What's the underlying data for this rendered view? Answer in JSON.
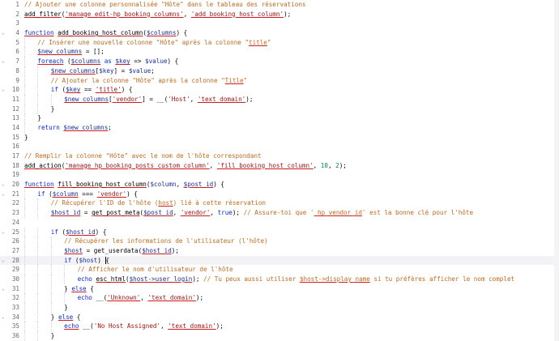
{
  "editor": {
    "lines": [
      {
        "n": "1",
        "fold": "",
        "ind": 0,
        "tokens": [
          {
            "t": "// Ajouter une colonne personnalisée \"Hôte\" dans le tableau des réservations",
            "c": "comment"
          }
        ]
      },
      {
        "n": "2",
        "fold": "",
        "ind": 0,
        "tokens": [
          {
            "t": "add_filter",
            "c": "function",
            "e": 1
          },
          {
            "t": "(",
            "c": "plain"
          },
          {
            "t": "'manage_edit-hp_booking_columns'",
            "c": "string",
            "e": 1
          },
          {
            "t": ", ",
            "c": "plain"
          },
          {
            "t": "'add_booking_host_column'",
            "c": "string",
            "e": 1
          },
          {
            "t": ");",
            "c": "plain"
          }
        ]
      },
      {
        "n": "3",
        "fold": "",
        "ind": 0,
        "tokens": []
      },
      {
        "n": "4",
        "fold": "v",
        "ind": 0,
        "tokens": [
          {
            "t": "function",
            "c": "keyword",
            "e": 1
          },
          {
            "t": " ",
            "c": "plain"
          },
          {
            "t": "add_booking_host_column",
            "c": "function",
            "e": 1
          },
          {
            "t": "(",
            "c": "plain"
          },
          {
            "t": "$columns",
            "c": "variable",
            "e": 1
          },
          {
            "t": ") {",
            "c": "plain"
          }
        ]
      },
      {
        "n": "5",
        "fold": "",
        "ind": 1,
        "tokens": [
          {
            "t": "// Insérer une nouvelle colonne \"Hôte\" après la colonne \"",
            "c": "comment"
          },
          {
            "t": "title",
            "c": "comment",
            "e": 1
          },
          {
            "t": "\"",
            "c": "comment"
          }
        ]
      },
      {
        "n": "6",
        "fold": "",
        "ind": 1,
        "tokens": [
          {
            "t": "$new_columns",
            "c": "variable",
            "e": 1
          },
          {
            "t": " = [];",
            "c": "plain"
          }
        ]
      },
      {
        "n": "7",
        "fold": "v",
        "ind": 1,
        "tokens": [
          {
            "t": "foreach",
            "c": "keyword",
            "e": 1
          },
          {
            "t": " (",
            "c": "plain"
          },
          {
            "t": "$columns",
            "c": "variable",
            "e": 1
          },
          {
            "t": " as ",
            "c": "keyword"
          },
          {
            "t": "$key",
            "c": "variable",
            "e": 1
          },
          {
            "t": " => ",
            "c": "plain"
          },
          {
            "t": "$value",
            "c": "variable"
          },
          {
            "t": ") {",
            "c": "plain"
          }
        ]
      },
      {
        "n": "8",
        "fold": "",
        "ind": 2,
        "tokens": [
          {
            "t": "$new_columns",
            "c": "variable",
            "e": 1
          },
          {
            "t": "[",
            "c": "plain"
          },
          {
            "t": "$key",
            "c": "variable"
          },
          {
            "t": "] = ",
            "c": "plain"
          },
          {
            "t": "$value",
            "c": "variable"
          },
          {
            "t": ";",
            "c": "plain"
          }
        ]
      },
      {
        "n": "9",
        "fold": "",
        "ind": 2,
        "tokens": [
          {
            "t": "// Ajouter la colonne \"Hôte\" après la colonne \"",
            "c": "comment"
          },
          {
            "t": "Title",
            "c": "comment",
            "e": 1
          },
          {
            "t": "\"",
            "c": "comment"
          }
        ]
      },
      {
        "n": "10",
        "fold": "v",
        "ind": 2,
        "tokens": [
          {
            "t": "if",
            "c": "keyword"
          },
          {
            "t": " (",
            "c": "plain"
          },
          {
            "t": "$key",
            "c": "variable",
            "e": 1
          },
          {
            "t": " == ",
            "c": "plain"
          },
          {
            "t": "'title'",
            "c": "string",
            "e": 1
          },
          {
            "t": ") {",
            "c": "plain"
          }
        ]
      },
      {
        "n": "11",
        "fold": "",
        "ind": 3,
        "tokens": [
          {
            "t": "$new_columns",
            "c": "variable",
            "e": 1
          },
          {
            "t": "[",
            "c": "plain"
          },
          {
            "t": "'vendor'",
            "c": "string",
            "e": 1
          },
          {
            "t": "] = __(",
            "c": "plain"
          },
          {
            "t": "'Host'",
            "c": "string"
          },
          {
            "t": ", ",
            "c": "plain"
          },
          {
            "t": "'text_domain'",
            "c": "string",
            "e": 1
          },
          {
            "t": ");",
            "c": "plain"
          }
        ]
      },
      {
        "n": "12",
        "fold": "",
        "ind": 2,
        "tokens": [
          {
            "t": "}",
            "c": "plain"
          }
        ]
      },
      {
        "n": "13",
        "fold": "",
        "ind": 1,
        "tokens": [
          {
            "t": "}",
            "c": "plain"
          }
        ]
      },
      {
        "n": "14",
        "fold": "",
        "ind": 1,
        "tokens": [
          {
            "t": "return",
            "c": "keyword"
          },
          {
            "t": " ",
            "c": "plain"
          },
          {
            "t": "$new_columns",
            "c": "variable",
            "e": 1
          },
          {
            "t": ";",
            "c": "plain"
          }
        ]
      },
      {
        "n": "15",
        "fold": "",
        "ind": 0,
        "tokens": [
          {
            "t": "}",
            "c": "plain"
          }
        ]
      },
      {
        "n": "16",
        "fold": "",
        "ind": 0,
        "tokens": []
      },
      {
        "n": "17",
        "fold": "",
        "ind": 0,
        "tokens": [
          {
            "t": "// Remplir la colonne \"Hôte\" avec le nom de l'hôte correspondant",
            "c": "comment"
          }
        ]
      },
      {
        "n": "18",
        "fold": "",
        "ind": 0,
        "tokens": [
          {
            "t": "add_action",
            "c": "function",
            "e": 1
          },
          {
            "t": "(",
            "c": "plain"
          },
          {
            "t": "'manage_hp_booking_posts_custom_column'",
            "c": "string",
            "e": 1
          },
          {
            "t": ", ",
            "c": "plain"
          },
          {
            "t": "'fill_booking_host_column'",
            "c": "string",
            "e": 1
          },
          {
            "t": ", ",
            "c": "plain"
          },
          {
            "t": "10",
            "c": "number"
          },
          {
            "t": ", ",
            "c": "plain"
          },
          {
            "t": "2",
            "c": "number"
          },
          {
            "t": ");",
            "c": "plain"
          }
        ]
      },
      {
        "n": "19",
        "fold": "",
        "ind": 0,
        "tokens": []
      },
      {
        "n": "20",
        "fold": "v",
        "ind": 0,
        "tokens": [
          {
            "t": "function",
            "c": "keyword",
            "e": 1
          },
          {
            "t": " ",
            "c": "plain"
          },
          {
            "t": "fill_booking_host_column",
            "c": "function",
            "e": 1
          },
          {
            "t": "(",
            "c": "plain"
          },
          {
            "t": "$column",
            "c": "variable"
          },
          {
            "t": ", ",
            "c": "plain"
          },
          {
            "t": "$post_id",
            "c": "variable",
            "e": 1
          },
          {
            "t": ") {",
            "c": "plain"
          }
        ]
      },
      {
        "n": "21",
        "fold": "v",
        "ind": 1,
        "tokens": [
          {
            "t": "if",
            "c": "keyword"
          },
          {
            "t": " (",
            "c": "plain"
          },
          {
            "t": "$column",
            "c": "variable",
            "e": 1
          },
          {
            "t": " === ",
            "c": "plain"
          },
          {
            "t": "'vendor'",
            "c": "string",
            "e": 1
          },
          {
            "t": ") {",
            "c": "plain"
          }
        ]
      },
      {
        "n": "22",
        "fold": "",
        "ind": 2,
        "tokens": [
          {
            "t": "// Récupérer l'ID de l'hôte (",
            "c": "comment"
          },
          {
            "t": "host",
            "c": "comment",
            "e": 1
          },
          {
            "t": ") lié à cette réservation",
            "c": "comment"
          }
        ]
      },
      {
        "n": "23",
        "fold": "",
        "ind": 2,
        "tokens": [
          {
            "t": "$host_id",
            "c": "variable",
            "e": 1
          },
          {
            "t": " = ",
            "c": "plain"
          },
          {
            "t": "get_post_meta",
            "c": "function",
            "e": 1
          },
          {
            "t": "(",
            "c": "plain"
          },
          {
            "t": "$post_id",
            "c": "variable",
            "e": 1
          },
          {
            "t": ", ",
            "c": "plain"
          },
          {
            "t": "'vendor'",
            "c": "string",
            "e": 1
          },
          {
            "t": ", ",
            "c": "plain"
          },
          {
            "t": "true",
            "c": "keyword"
          },
          {
            "t": "); ",
            "c": "plain"
          },
          {
            "t": "// Assure-toi que '",
            "c": "comment"
          },
          {
            "t": "_hp_vendor_id",
            "c": "comment",
            "e": 1
          },
          {
            "t": "' est la bonne clé pour l'hôte",
            "c": "comment"
          }
        ]
      },
      {
        "n": "24",
        "fold": "",
        "ind": 0,
        "tokens": []
      },
      {
        "n": "25",
        "fold": "v",
        "ind": 2,
        "tokens": [
          {
            "t": "if",
            "c": "keyword"
          },
          {
            "t": " (",
            "c": "plain"
          },
          {
            "t": "$host_id",
            "c": "variable",
            "e": 1
          },
          {
            "t": ") {",
            "c": "plain"
          }
        ]
      },
      {
        "n": "26",
        "fold": "",
        "ind": 3,
        "tokens": [
          {
            "t": "// Récupérer les informations de l'utilisateur (l'hôte)",
            "c": "comment"
          }
        ]
      },
      {
        "n": "27",
        "fold": "",
        "ind": 3,
        "tokens": [
          {
            "t": "$host",
            "c": "variable",
            "e": 1
          },
          {
            "t": " = ",
            "c": "plain"
          },
          {
            "t": "get_userdata",
            "c": "function"
          },
          {
            "t": "(",
            "c": "plain"
          },
          {
            "t": "$host_id",
            "c": "variable",
            "e": 1
          },
          {
            "t": ");",
            "c": "plain"
          }
        ]
      },
      {
        "n": "28",
        "fold": "v",
        "ind": 3,
        "cur": 1,
        "tokens": [
          {
            "t": "if",
            "c": "keyword"
          },
          {
            "t": " (",
            "c": "plain"
          },
          {
            "t": "$host",
            "c": "variable"
          },
          {
            "t": ") ",
            "c": "plain"
          },
          {
            "t": "{",
            "c": "plain",
            "cursor": 1
          }
        ]
      },
      {
        "n": "29",
        "fold": "",
        "ind": 4,
        "tokens": [
          {
            "t": "// Afficher le nom d'utilisateur de l'hôte",
            "c": "comment"
          }
        ]
      },
      {
        "n": "30",
        "fold": "",
        "ind": 4,
        "tokens": [
          {
            "t": "echo",
            "c": "keyword"
          },
          {
            "t": " ",
            "c": "plain"
          },
          {
            "t": "esc_html",
            "c": "function",
            "e": 1
          },
          {
            "t": "(",
            "c": "plain"
          },
          {
            "t": "$host->user_login",
            "c": "variable",
            "e": 1
          },
          {
            "t": "); ",
            "c": "plain"
          },
          {
            "t": "// Tu peux aussi utiliser ",
            "c": "comment"
          },
          {
            "t": "$host->display_name",
            "c": "comment",
            "e": 1
          },
          {
            "t": " si tu préfères afficher le nom complet",
            "c": "comment"
          }
        ]
      },
      {
        "n": "31",
        "fold": "v",
        "ind": 3,
        "tokens": [
          {
            "t": "} ",
            "c": "plain"
          },
          {
            "t": "else",
            "c": "keyword",
            "e": 1
          },
          {
            "t": " {",
            "c": "plain"
          }
        ]
      },
      {
        "n": "32",
        "fold": "",
        "ind": 4,
        "tokens": [
          {
            "t": "echo",
            "c": "keyword"
          },
          {
            "t": " __(",
            "c": "plain"
          },
          {
            "t": "'Unknown'",
            "c": "string",
            "e": 1
          },
          {
            "t": ", ",
            "c": "plain"
          },
          {
            "t": "'text_domain'",
            "c": "string",
            "e": 1
          },
          {
            "t": ");",
            "c": "plain"
          }
        ]
      },
      {
        "n": "33",
        "fold": "",
        "ind": 3,
        "tokens": [
          {
            "t": "}",
            "c": "plain"
          }
        ]
      },
      {
        "n": "34",
        "fold": "v",
        "ind": 2,
        "tokens": [
          {
            "t": "} ",
            "c": "plain"
          },
          {
            "t": "else",
            "c": "keyword",
            "e": 1
          },
          {
            "t": " {",
            "c": "plain"
          }
        ]
      },
      {
        "n": "35",
        "fold": "",
        "ind": 3,
        "tokens": [
          {
            "t": "echo",
            "c": "keyword",
            "e": 1
          },
          {
            "t": " __(",
            "c": "plain"
          },
          {
            "t": "'No Host Assigned'",
            "c": "string"
          },
          {
            "t": ", ",
            "c": "plain"
          },
          {
            "t": "'text_domain'",
            "c": "string",
            "e": 1
          },
          {
            "t": ");",
            "c": "plain"
          }
        ]
      },
      {
        "n": "36",
        "fold": "",
        "ind": 2,
        "tokens": [
          {
            "t": "}",
            "c": "plain"
          }
        ]
      },
      {
        "n": "37",
        "fold": "",
        "ind": 1,
        "tokens": [
          {
            "t": "}",
            "c": "plain"
          }
        ]
      }
    ]
  }
}
